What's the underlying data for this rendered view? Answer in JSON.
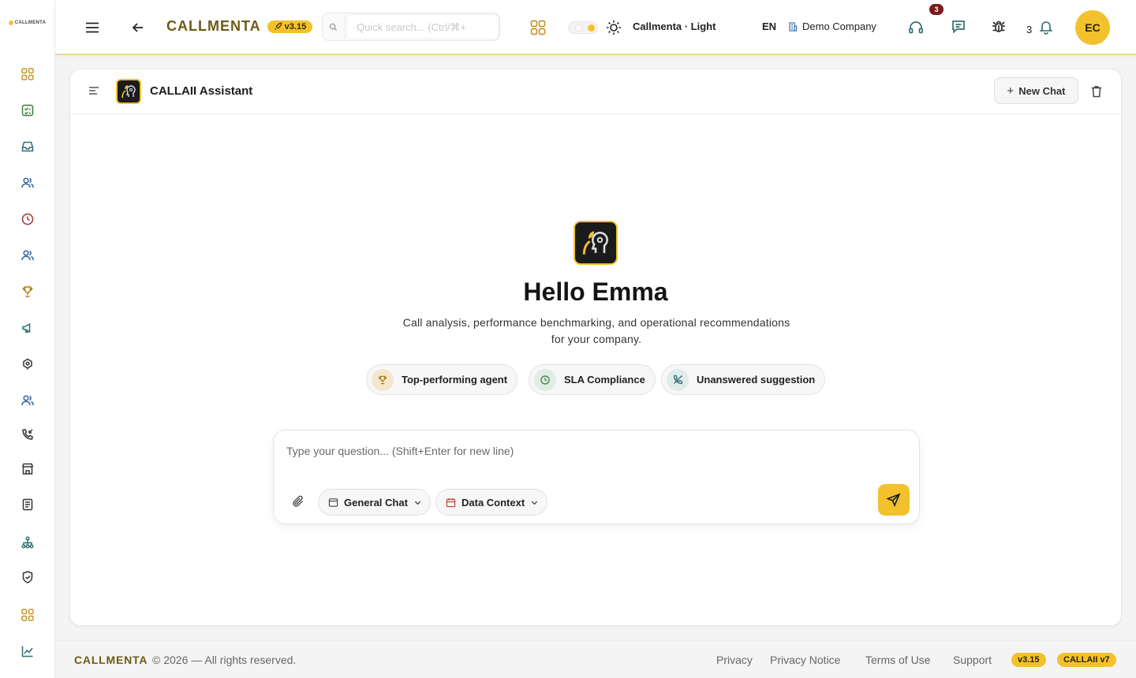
{
  "sidebar": {
    "logo_text": "CALLMENTA",
    "items": [
      {
        "icon": "dashboard-icon",
        "color": "#c8962a"
      },
      {
        "icon": "checklist-icon",
        "color": "#3d7a3d"
      },
      {
        "icon": "inbox-icon",
        "color": "#2f6f6f"
      },
      {
        "icon": "users-icon",
        "color": "#2f5f9f"
      },
      {
        "icon": "clock-icon",
        "color": "#a3303a"
      },
      {
        "icon": "team-icon",
        "color": "#2f5f9f"
      },
      {
        "icon": "trophy-icon",
        "color": "#b07a10"
      },
      {
        "icon": "megaphone-icon",
        "color": "#2f6f6f"
      },
      {
        "icon": "integration-icon",
        "color": "#333"
      },
      {
        "icon": "agents-icon",
        "color": "#2f5f9f"
      },
      {
        "icon": "phone-incoming-icon",
        "color": "#333"
      },
      {
        "icon": "store-icon",
        "color": "#333"
      },
      {
        "icon": "report-icon",
        "color": "#333"
      },
      {
        "icon": "sitemap-icon",
        "color": "#2f6f6f"
      },
      {
        "icon": "shield-icon",
        "color": "#333"
      },
      {
        "icon": "apps-icon",
        "color": "#c8962a"
      },
      {
        "icon": "chart-line-icon",
        "color": "#2f6f6f"
      }
    ]
  },
  "topbar": {
    "brand": "CALLMENTA",
    "version_badge": "v3.15",
    "search_placeholder": "Quick search... (Ctrl/⌘+",
    "theme_label": "Callmenta · Light",
    "language": "EN",
    "company": "Demo Company",
    "support_badge": "3",
    "notification_count": "3",
    "avatar_initials": "EC"
  },
  "assistant": {
    "title": "CALLAII Assistant",
    "new_chat_label": "New Chat",
    "greeting": "Hello Emma",
    "subtitle_line1": "Call analysis, performance benchmarking, and operational recommendations",
    "subtitle_line2": "for your company.",
    "suggestions": [
      {
        "label": "Top-performing agent",
        "icon": "trophy-icon"
      },
      {
        "label": "SLA Compliance",
        "icon": "clock-icon"
      },
      {
        "label": "Unanswered suggestion",
        "icon": "phone-missed-icon"
      }
    ],
    "composer_placeholder": "Type your question... (Shift+Enter for new line)",
    "mode_label": "General Chat",
    "context_label": "Data Context"
  },
  "footer": {
    "brand": "CALLMENTA",
    "copyright": "© 2026 — All rights reserved.",
    "links": [
      "Privacy",
      "Privacy Notice",
      "Terms of Use",
      "Support"
    ],
    "version_badge": "v3.15",
    "ai_badge": "CALLAII v7"
  },
  "colors": {
    "accent": "#f3c12b",
    "brand_text": "#6e5a16",
    "badge_dark": "#7b1b1b"
  }
}
